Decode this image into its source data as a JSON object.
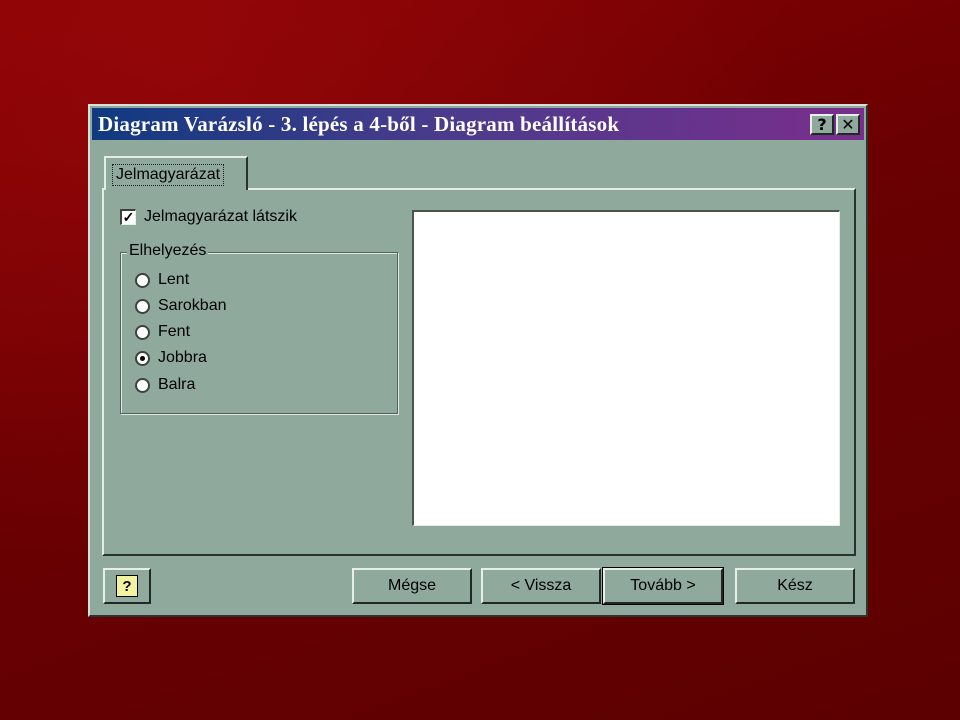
{
  "dialog": {
    "title": "Diagram Varázsló - 3. lépés a 4-ből - Diagram beállítások",
    "help_button": "?",
    "close_button": "✕"
  },
  "tabs": [
    {
      "label": "Jelmagyarázat",
      "active": true
    }
  ],
  "legend_checkbox": {
    "label": "Jelmagyarázat látszik",
    "checked": true
  },
  "placement": {
    "group_title": "Elhelyezés",
    "options": [
      {
        "label": "Lent",
        "checked": false
      },
      {
        "label": "Sarokban",
        "checked": false
      },
      {
        "label": "Fent",
        "checked": false
      },
      {
        "label": "Jobbra",
        "checked": true
      },
      {
        "label": "Balra",
        "checked": false
      }
    ]
  },
  "buttons": {
    "help_icon": "?",
    "cancel": "Mégse",
    "back": "< Vissza",
    "next": "Tovább >",
    "finish": "Kész"
  },
  "colors": {
    "background": "#6a0002",
    "dialog_face": "#8faa9c",
    "titlebar_start": "#103a80",
    "titlebar_end": "#7a2e8c"
  }
}
